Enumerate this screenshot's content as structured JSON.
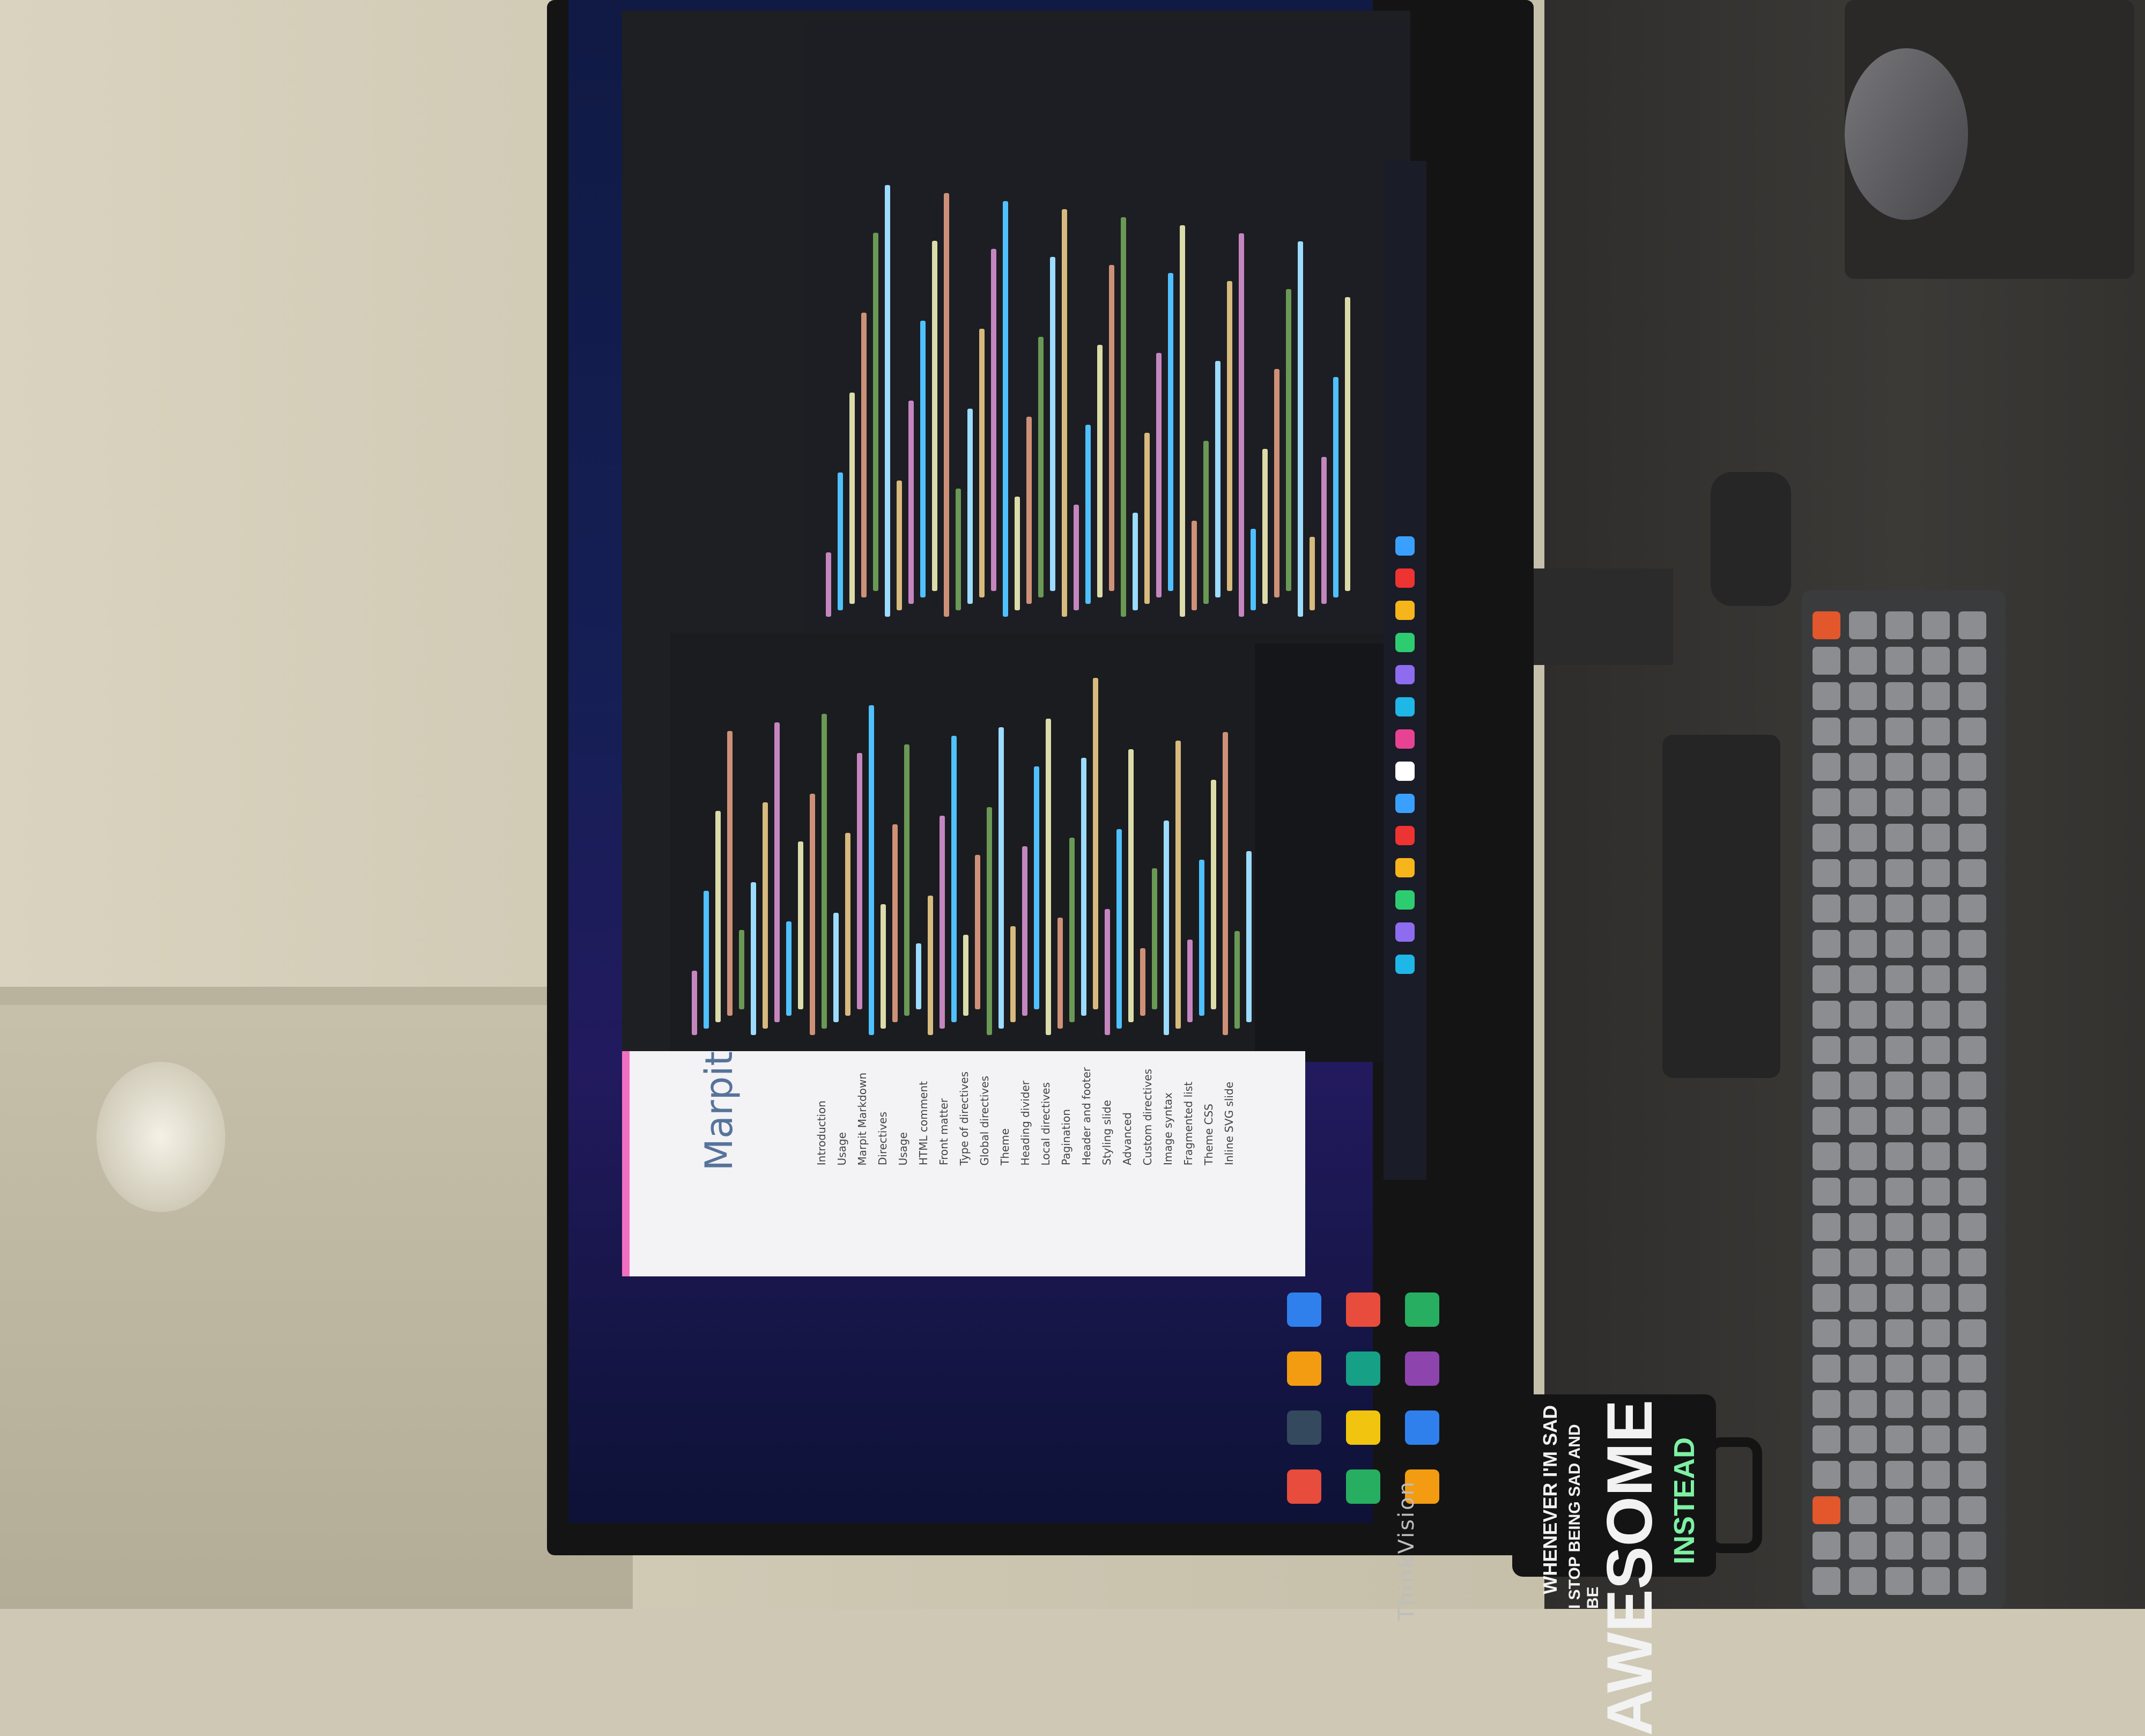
{
  "scene": {
    "monitor_brand": "ThinkVision",
    "browser_app_title": "Marpit",
    "browser_nav": [
      "Introduction",
      "Usage",
      "Marpit Markdown",
      "Directives",
      "Usage",
      "HTML comment",
      "Front matter",
      "Type of directives",
      "Global directives",
      "Theme",
      "Heading divider",
      "Local directives",
      "Pagination",
      "Header and footer",
      "Styling slide",
      "Advanced",
      "Custom directives",
      "Image syntax",
      "Fragmented list",
      "Theme CSS",
      "Inline SVG slide"
    ],
    "mug_text": {
      "line1": "WHENEVER I'M SAD",
      "line2": "I STOP BEING SAD AND BE",
      "line3": "AWESOME",
      "line4": "INSTEAD"
    }
  },
  "colors": {
    "browser_accent": "#f06fc1",
    "editor_bg": "#1e1f22",
    "desktop_bg": "#151f55",
    "keyboard_accent": "#e2572c",
    "mug_accent": "#7ef0a4"
  }
}
